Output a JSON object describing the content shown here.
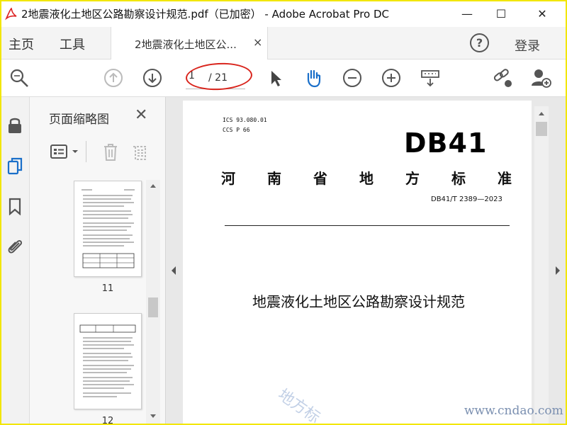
{
  "window": {
    "title": "2地震液化土地区公路勘察设计规范.pdf（已加密） - Adobe Acrobat Pro DC",
    "minimize": "—",
    "maximize": "☐",
    "close": "✕"
  },
  "menu": {
    "home": "主页",
    "tools": "工具",
    "doc_tab": "2地震液化土地区公...",
    "doc_tab_close": "×",
    "help": "?",
    "login": "登录"
  },
  "toolbar": {
    "page_current": "1",
    "page_total": "/ 21"
  },
  "panel": {
    "title": "页面缩略图",
    "close": "✕",
    "thumbs": [
      {
        "label": "11"
      },
      {
        "label": "12"
      }
    ]
  },
  "document": {
    "ics": "ICS  93.080.01",
    "ccs": "CCS  P 66",
    "logo": "DB41",
    "standard_title_chars": [
      "河",
      "南",
      "省",
      "地",
      "方",
      "标",
      "准"
    ],
    "standard_code": "DB41/T 2389—2023",
    "doc_title": "地震液化土地区公路勘察设计规范"
  },
  "watermark": {
    "url": "www.cndao.com",
    "diag": "地方标"
  }
}
